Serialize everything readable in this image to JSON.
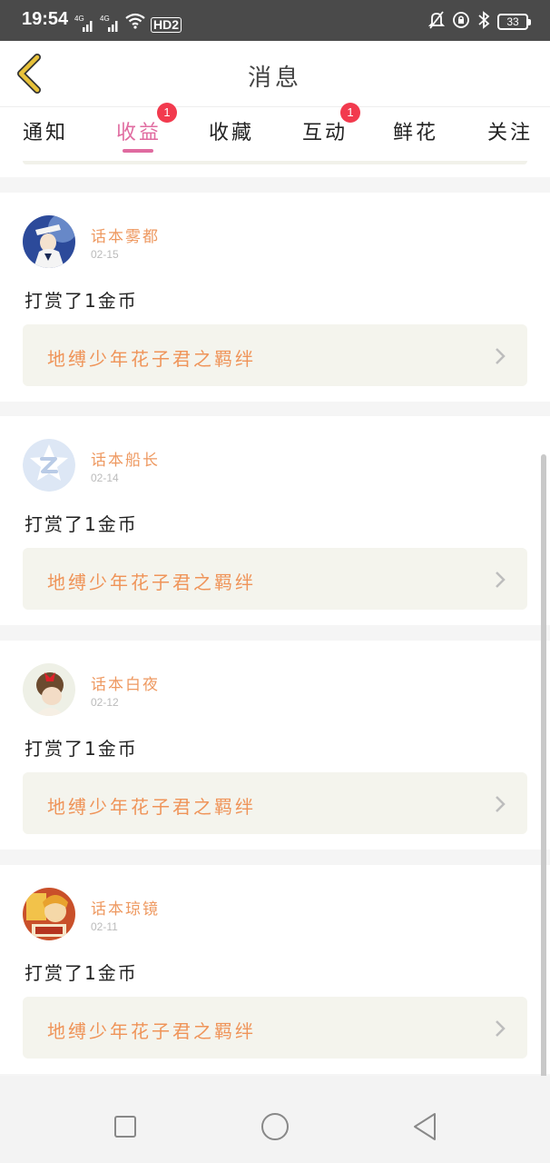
{
  "status_bar": {
    "time": "19:54",
    "network_1": "4G",
    "network_2": "4G",
    "hd_label": "HD2",
    "battery": "33"
  },
  "header": {
    "title": "消息"
  },
  "tabs": [
    {
      "label": "通知",
      "active": false
    },
    {
      "label": "收益",
      "active": true,
      "badge": "1"
    },
    {
      "label": "收藏",
      "active": false
    },
    {
      "label": "互动",
      "active": false,
      "badge": "1"
    },
    {
      "label": "鲜花",
      "active": false
    },
    {
      "label": "关注",
      "active": false
    }
  ],
  "messages": [
    {
      "sender": "话本雾都",
      "date": "02-15",
      "action": "打赏了1金币",
      "book": "地缚少年花子君之羁绊",
      "avatar": "anime-avatar-blue"
    },
    {
      "sender": "话本船长",
      "date": "02-14",
      "action": "打赏了1金币",
      "book": "地缚少年花子君之羁绊",
      "avatar": "default-logo-avatar"
    },
    {
      "sender": "话本白夜",
      "date": "02-12",
      "action": "打赏了1金币",
      "book": "地缚少年花子君之羁绊",
      "avatar": "girl-red-bow-avatar"
    },
    {
      "sender": "话本琼镜",
      "date": "02-11",
      "action": "打赏了1金币",
      "book": "地缚少年花子君之羁绊",
      "avatar": "cartoon-orange-avatar"
    }
  ],
  "colors": {
    "accent": "#e06ba0",
    "sender": "#ee9961",
    "book_title": "#ef9459",
    "badge": "#f23a4e",
    "back_arrow": "#e8c23a"
  }
}
